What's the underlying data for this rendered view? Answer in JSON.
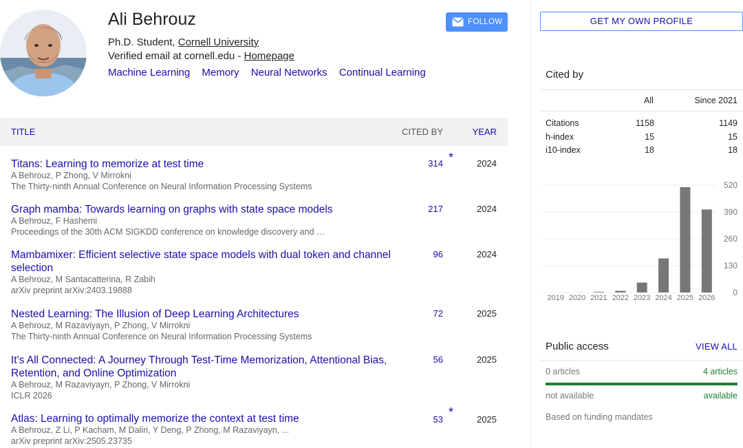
{
  "profile": {
    "name": "Ali Behrouz",
    "role": "Ph.D. Student, ",
    "institution": "Cornell University",
    "email_text": "Verified email at cornell.edu - ",
    "homepage": "Homepage",
    "interests": [
      "Machine Learning",
      "Memory",
      "Neural Networks",
      "Continual Learning"
    ],
    "follow_label": "FOLLOW"
  },
  "table": {
    "headers": {
      "title": "TITLE",
      "cited_by": "CITED BY",
      "year": "YEAR"
    },
    "rows": [
      {
        "title": "Titans: Learning to memorize at test time",
        "authors": "A Behrouz, P Zhong, V Mirrokni",
        "venue": "The Thirty-ninth Annual Conference on Neural Information Processing Systems",
        "cited_by": "314",
        "star": "*",
        "year": "2024"
      },
      {
        "title": "Graph mamba: Towards learning on graphs with state space models",
        "authors": "A Behrouz, F Hashemi",
        "venue": "Proceedings of the 30th ACM SIGKDD conference on knowledge discovery and …",
        "cited_by": "217",
        "star": "",
        "year": "2024"
      },
      {
        "title": "Mambamixer: Efficient selective state space models with dual token and channel selection",
        "authors": "A Behrouz, M Santacatterina, R Zabih",
        "venue": "arXiv preprint arXiv:2403.19888",
        "cited_by": "96",
        "star": "",
        "year": "2024"
      },
      {
        "title": "Nested Learning: The Illusion of Deep Learning Architectures",
        "authors": "A Behrouz, M Razaviyayn, P Zhong, V Mirrokni",
        "venue": "The Thirty-ninth Annual Conference on Neural Information Processing Systems",
        "cited_by": "72",
        "star": "",
        "year": "2025"
      },
      {
        "title": "It's All Connected: A Journey Through Test-Time Memorization, Attentional Bias, Retention, and Online Optimization",
        "authors": "A Behrouz, M Razaviyayn, P Zhong, V Mirrokni",
        "venue": "ICLR 2026",
        "cited_by": "56",
        "star": "",
        "year": "2025"
      },
      {
        "title": "Atlas: Learning to optimally memorize the context at test time",
        "authors": "A Behrouz, Z Li, P Kacham, M Daliri, Y Deng, P Zhong, M Razaviyayn, ...",
        "venue": "arXiv preprint arXiv:2505.23735",
        "cited_by": "53",
        "star": "*",
        "year": "2025"
      }
    ]
  },
  "sidebar": {
    "own_profile_label": "GET MY OWN PROFILE",
    "cited_by_title": "Cited by",
    "stats_headers": {
      "all": "All",
      "since": "Since 2021"
    },
    "stats": [
      {
        "label": "Citations",
        "all": "1158",
        "since": "1149"
      },
      {
        "label": "h-index",
        "all": "15",
        "since": "15"
      },
      {
        "label": "i10-index",
        "all": "18",
        "since": "18"
      }
    ],
    "public_access": {
      "title": "Public access",
      "view_all": "VIEW ALL",
      "not_available_count": "0 articles",
      "available_count": "4 articles",
      "not_available_label": "not available",
      "available_label": "available",
      "note": "Based on funding mandates",
      "available_color": "#1e7e34"
    }
  },
  "chart_data": {
    "type": "bar",
    "categories": [
      "2019",
      "2020",
      "2021",
      "2022",
      "2023",
      "2024",
      "2025",
      "2026"
    ],
    "values": [
      0,
      0,
      3,
      8,
      48,
      165,
      510,
      402
    ],
    "yticks": [
      0,
      130,
      260,
      390,
      520
    ],
    "ylim": [
      0,
      520
    ],
    "grid": true,
    "bar_color": "#777777"
  },
  "icons": {
    "follow": "mail-icon"
  },
  "colors": {
    "link": "#1a0dab",
    "follow_button": "#4d90fe"
  }
}
